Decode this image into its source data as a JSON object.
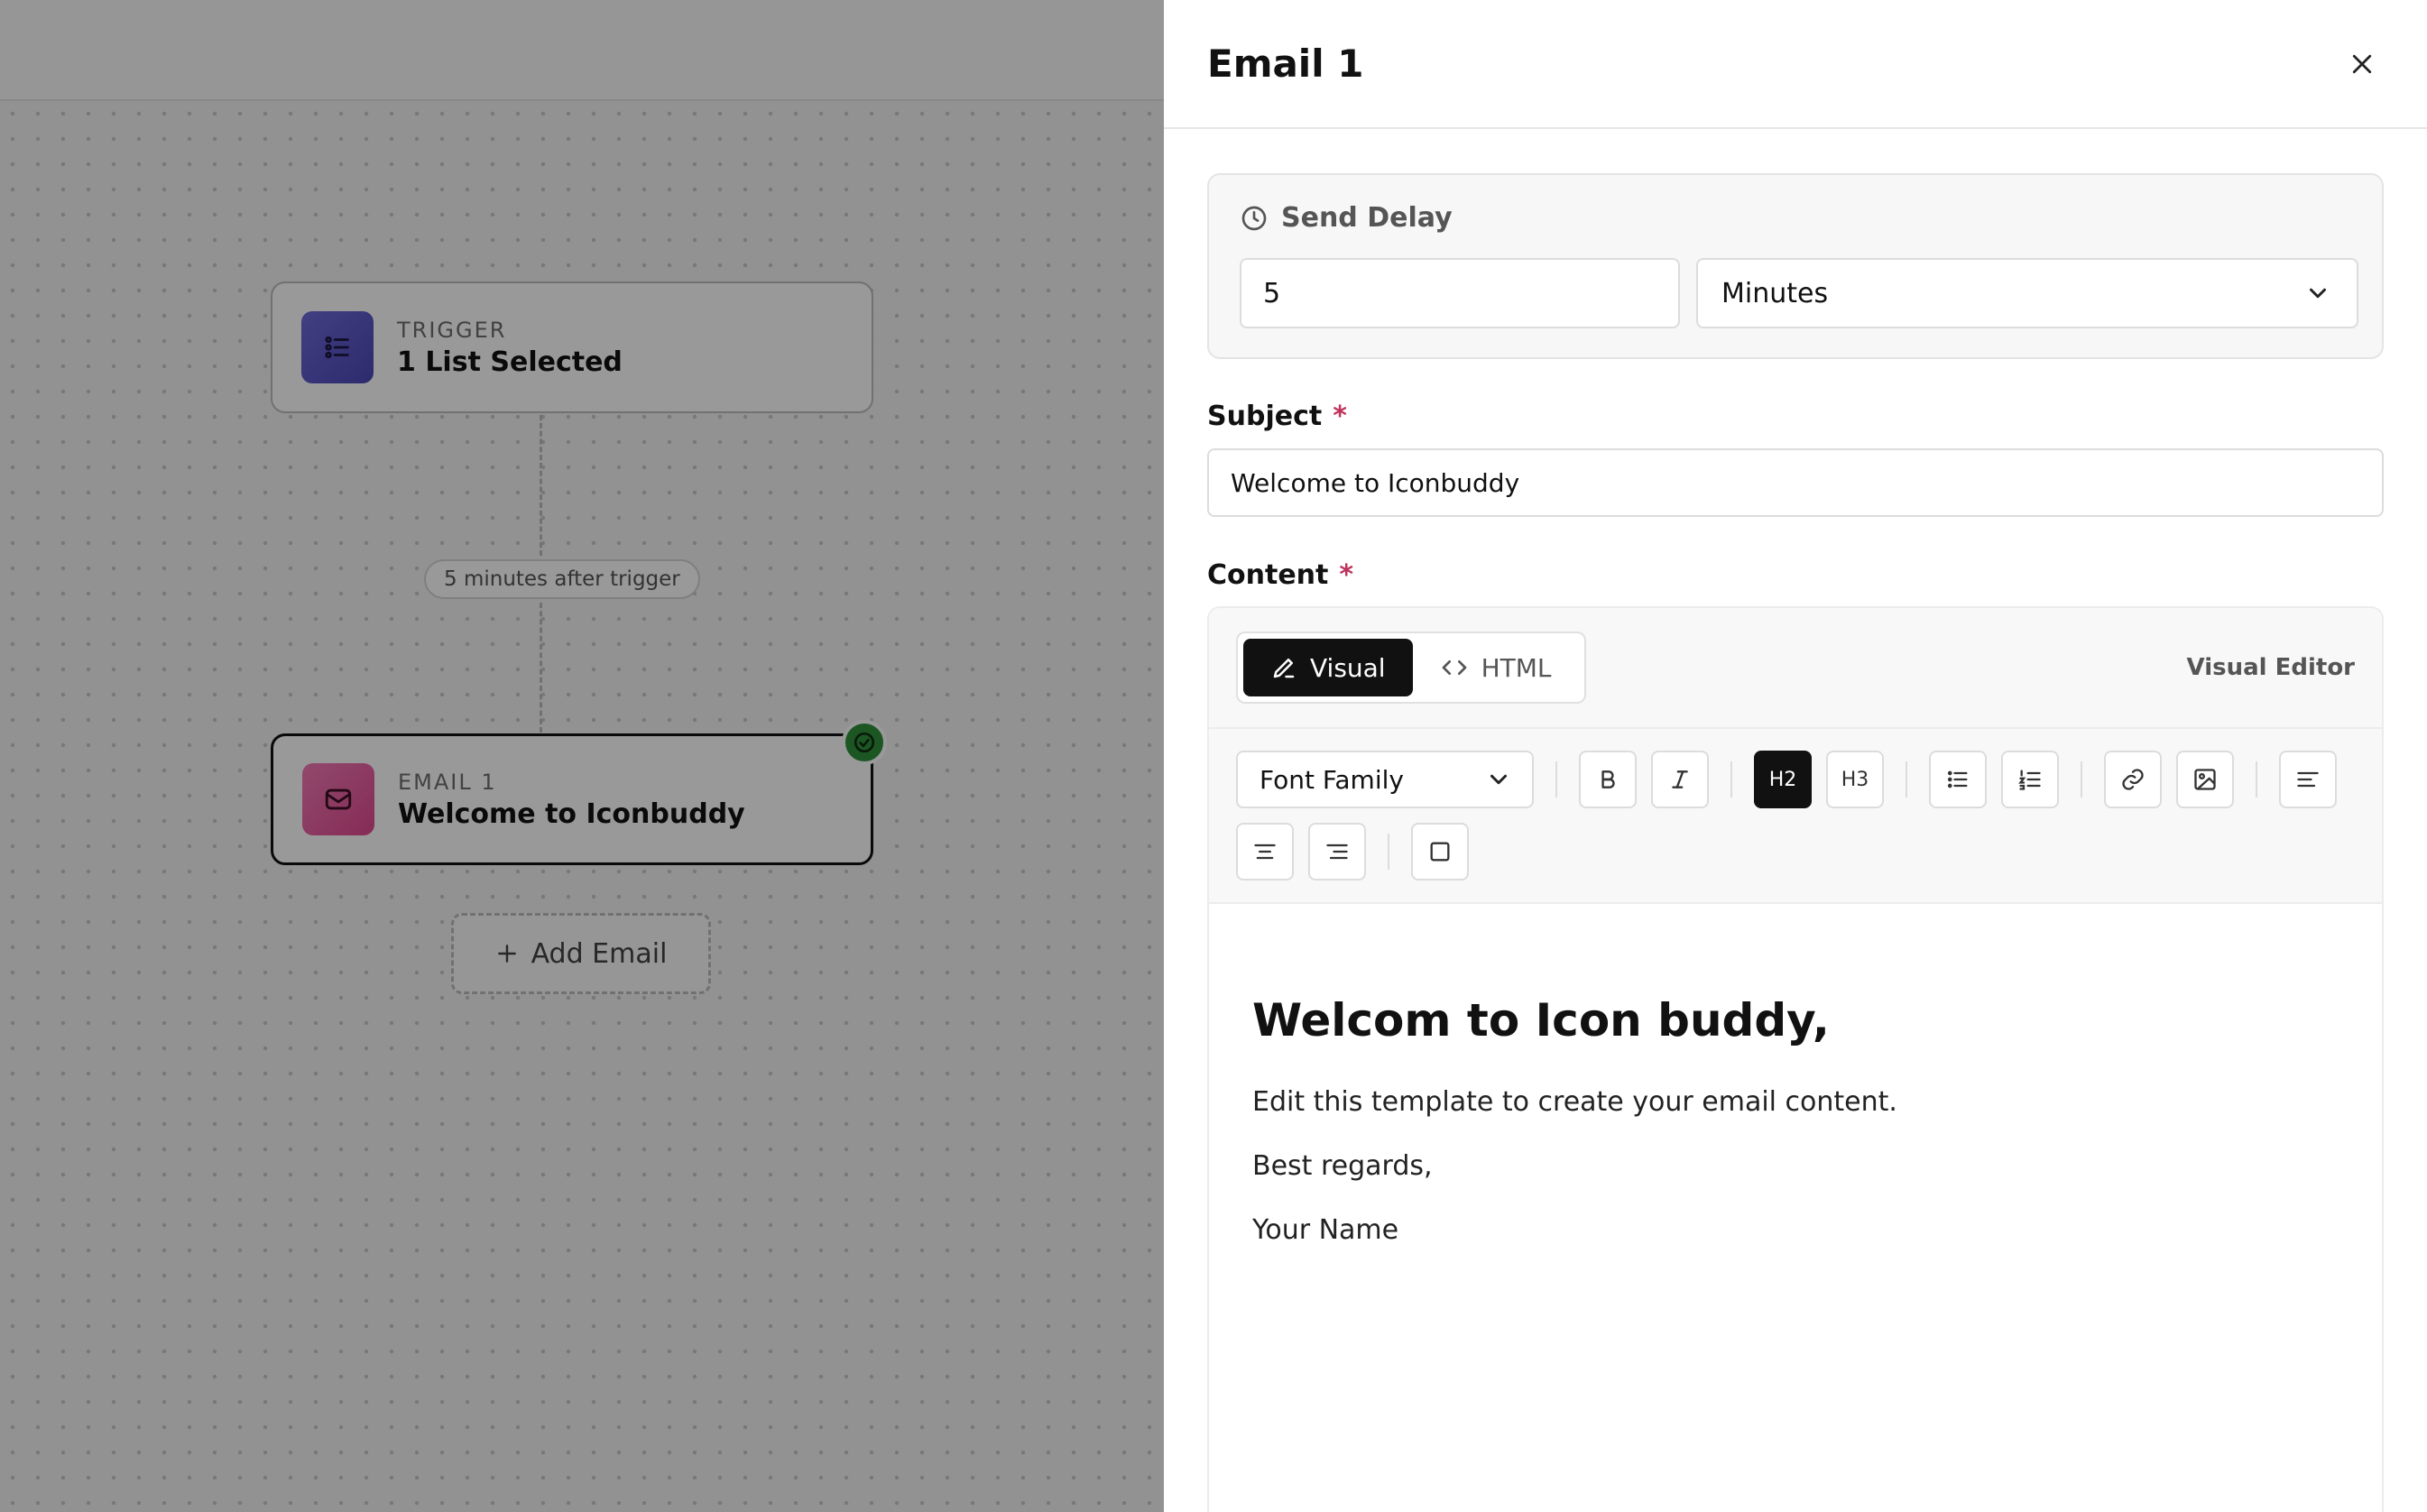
{
  "canvas": {
    "trigger_node": {
      "kicker": "TRIGGER",
      "title": "1 List Selected",
      "icon": "list-icon"
    },
    "delay_pill": "5 minutes after trigger",
    "email_node": {
      "kicker": "EMAIL 1",
      "title": "Welcome to Iconbuddy",
      "icon": "mail-icon",
      "status_icon": "check-circle-icon"
    },
    "add_email_label": "Add Email"
  },
  "panel": {
    "title": "Email 1",
    "send_delay": {
      "label": "Send Delay",
      "value": "5",
      "unit": "Minutes"
    },
    "subject": {
      "label": "Subject",
      "required_mark": "*",
      "value": "Welcome to Iconbuddy"
    },
    "content": {
      "label": "Content",
      "required_mark": "*",
      "tabs": [
        "Visual",
        "HTML"
      ],
      "active_tab": "Visual",
      "editor_mode_label": "Visual Editor",
      "toolbar": {
        "font_family_label": "Font Family",
        "h2_label": "H2",
        "h3_label": "H3"
      },
      "body": {
        "heading": "Welcom to Icon buddy,",
        "paragraphs": [
          "Edit this template to create your email content.",
          "Best regards,",
          "Your Name"
        ]
      }
    }
  },
  "colors": {
    "trigger_accent": "#5b55c9",
    "email_accent": "#e65a9c",
    "status_ok": "#2f8f3a",
    "required": "#c0325b"
  }
}
